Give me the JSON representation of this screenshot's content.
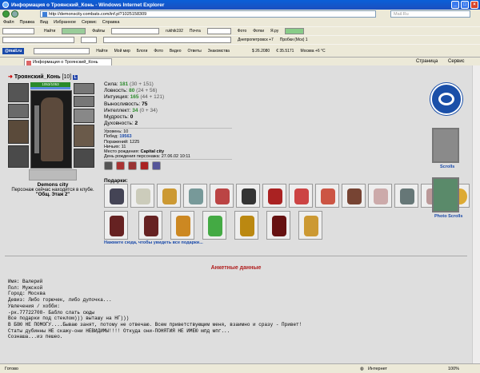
{
  "window": {
    "title": "Информация о Троянский_Конь - Windows Internet Explorer",
    "min": "_",
    "max": "□",
    "close": "×"
  },
  "address": {
    "url": "http://demonscity.combats.com/inf.pl?1025158309",
    "search_placeholder": "Mail.Ru"
  },
  "menu": [
    "Файл",
    "Правка",
    "Вид",
    "Избранное",
    "Сервис",
    "Справка"
  ],
  "toolbar1": {
    "items": [
      "Найти",
      "Файлы",
      "rukhik192",
      "Почта",
      "Фото",
      "Фотки",
      "Я.ру"
    ]
  },
  "toolbar2": {
    "items": [
      "Найти",
      "Мой мир",
      "Блоги",
      "Фото",
      "Видео",
      "Ответы",
      "Знакомства"
    ],
    "rates": [
      "$ 26.2080",
      "€ 35.5171"
    ],
    "weather": "Москва +6 °С",
    "dnepr": "Днепропетровск +7",
    "traffic": "Пробки (Мск) 1"
  },
  "tab": {
    "label": "Информация о Троянский_Конь",
    "page": "Страница",
    "service": "Сервис"
  },
  "status": {
    "left": "Готово",
    "zone": "Интернет",
    "zoom": "100%"
  },
  "character": {
    "name": "Троянский_Конь",
    "level": "[10]",
    "badge": "L",
    "hp": "1053/1053",
    "city": "Demons city",
    "location_line1": "Персонаж сейчас находится в клубе.",
    "location_line2": "\"Общ. Этаж 2\"",
    "stats": [
      {
        "label": "Сила:",
        "value": "181",
        "extra": "(30 + 151)"
      },
      {
        "label": "Ловкость:",
        "value": "80",
        "extra": "(24 + 56)"
      },
      {
        "label": "Интуиция:",
        "value": "165",
        "extra": "(44 + 121)"
      },
      {
        "label": "Выносливость:",
        "value": "75",
        "extra": ""
      },
      {
        "label": "Интеллект:",
        "value": "34",
        "extra": "(0 + 34)"
      },
      {
        "label": "Мудрость:",
        "value": "0",
        "extra": ""
      },
      {
        "label": "Духовность:",
        "value": "2",
        "extra": ""
      }
    ],
    "meta": [
      {
        "label": "Уровень:",
        "value": "10"
      },
      {
        "label": "Побед:",
        "value": "19563"
      },
      {
        "label": "Поражений:",
        "value": "1225"
      },
      {
        "label": "Ничьих:",
        "value": "11"
      },
      {
        "label": "Место рождения:",
        "value": "Capital city"
      },
      {
        "label": "День рождения персонажа:",
        "value": "27.06.02 10:11"
      }
    ]
  },
  "gifts": {
    "label": "Подарки:",
    "link": "Нажмите сюда, чтобы увидеть все подарки..."
  },
  "side": {
    "scrolls": "Scrolls",
    "photo_scrolls": "Photo Scrolls"
  },
  "anketa": {
    "title": "Анкетные данные",
    "lines": [
      "Имя: Валерий",
      "Пол: Мужской",
      "Город: Москва",
      "Девиз: Либо горючек, либо дупочка...",
      "Увлечения / хобби:",
      "-рк.77722708- Бабло слать сюды",
      "",
      "Все подарки под стеклом))) выташу на НГ)))",
      "",
      "В БОЮ НЕ ПОМОГУ....Бываю занят, потому не отвечаю. Всем приветствующим меня, взаимно и сразу - Привет!",
      "",
      "Статы дубинны НЕ скажу-они НЕВИДИМЫ!!!! Откуда они-ПОНЯТИЯ НЕ ИМЕЮ мпд мпг...",
      "",
      "Сознаша...из пешео."
    ]
  },
  "colors": {
    "accent": "#2c8a2c",
    "link": "#1a4aaa",
    "heading": "#b01c1c",
    "titlebar": "#0a5fd8"
  }
}
